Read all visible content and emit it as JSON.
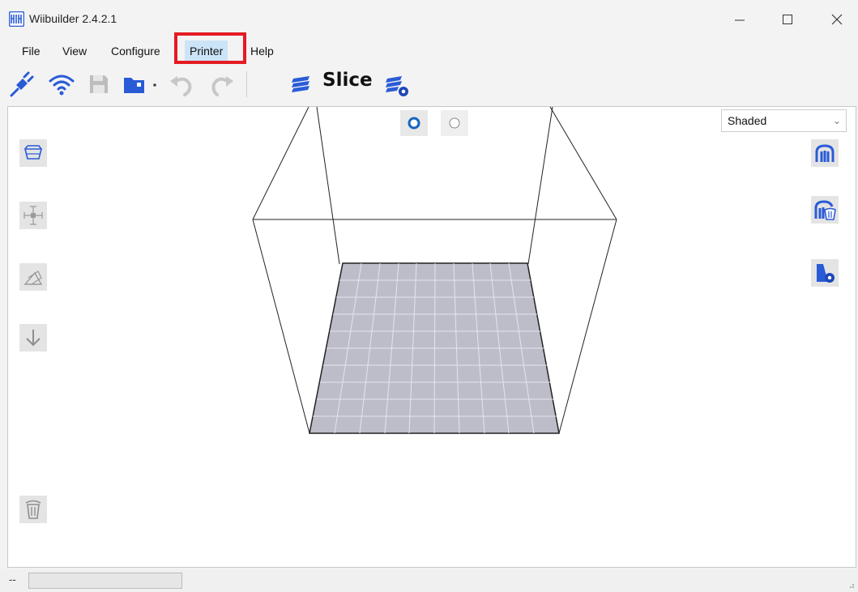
{
  "app": {
    "title": "Wiibuilder 2.4.2.1",
    "icon": "wiibuilder-logo-icon"
  },
  "window_controls": {
    "minimize_icon": "minimize-icon",
    "maximize_icon": "maximize-icon",
    "close_icon": "close-icon"
  },
  "menu": {
    "items": [
      {
        "label": "File"
      },
      {
        "label": "View"
      },
      {
        "label": "Configure"
      },
      {
        "label": "Printer"
      },
      {
        "label": "Help"
      }
    ],
    "active": "Printer",
    "highlight_color": "#e41b23"
  },
  "toolbar": {
    "icons": [
      "connect-icon",
      "wifi-icon",
      "save-icon",
      "open-folder-icon",
      "dropdown-arrow-icon",
      "undo-icon",
      "redo-icon",
      "slice-layers-icon",
      "slice-settings-icon"
    ],
    "slice_label": "Slice",
    "accent_color": "#2a5bd7"
  },
  "viewport": {
    "view_mode": "Shaded",
    "radio_options": [
      {
        "selected": true
      },
      {
        "selected": false
      }
    ],
    "left_tools": [
      "view-box-icon",
      "move-icon",
      "rotate-icon",
      "drop-down-icon",
      "delete-icon"
    ],
    "right_tools": [
      "support-icon",
      "support-delete-icon",
      "model-settings-icon"
    ]
  },
  "status": {
    "text": "--"
  }
}
